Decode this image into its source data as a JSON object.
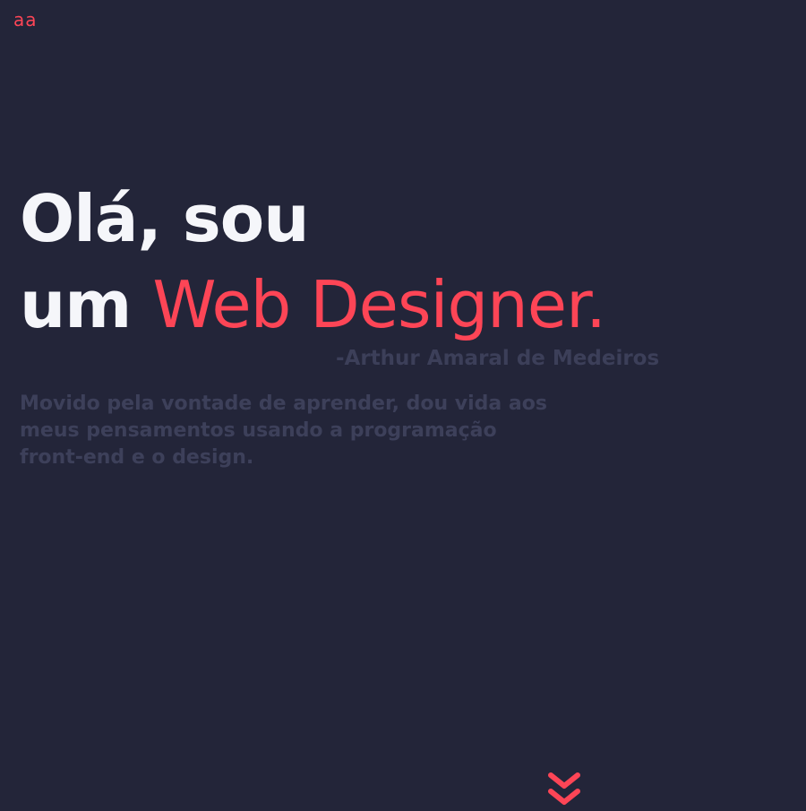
{
  "logo": {
    "text": "aa"
  },
  "hero": {
    "headline_line1": "Olá, sou",
    "headline_line2_prefix": "um",
    "headline_line2_accent": "Web Designer.",
    "signature": "-Arthur Amaral de Medeiros",
    "bio": "Movido pela vontade de aprender, dou vida aos meus pensamentos usando a programação front-end e o design."
  },
  "scroll_button": {
    "icon": "double-chevron-down-icon"
  },
  "colors": {
    "background": "#232539",
    "accent": "#fd4556",
    "headline": "#f5f6fa",
    "muted": "#3d405a"
  }
}
